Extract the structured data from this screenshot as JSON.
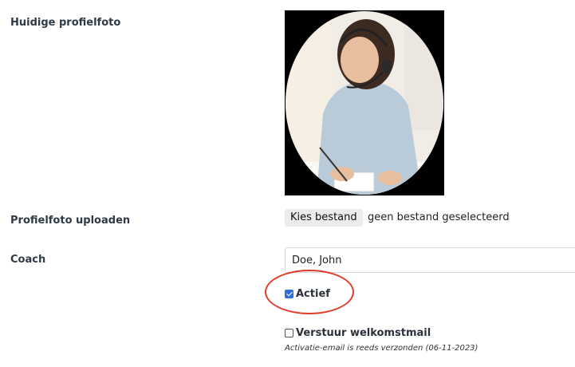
{
  "profile_photo": {
    "label": "Huidige profielfoto",
    "image_icon": "person-with-headset-photo"
  },
  "upload": {
    "label": "Profielfoto uploaden",
    "button_label": "Kies bestand",
    "status_text": "geen bestand geselecteerd"
  },
  "coach": {
    "label": "Coach",
    "value": "Doe, John"
  },
  "active_checkbox": {
    "label": "Actief",
    "checked": true
  },
  "welcome_mail_checkbox": {
    "label": "Verstuur welkomstmail",
    "checked": false,
    "note": "Activatie-email is reeds verzonden (06-11-2023)"
  },
  "colors": {
    "checkbox_accent": "#2f6fd6",
    "highlight_ring": "#e23b2a"
  }
}
